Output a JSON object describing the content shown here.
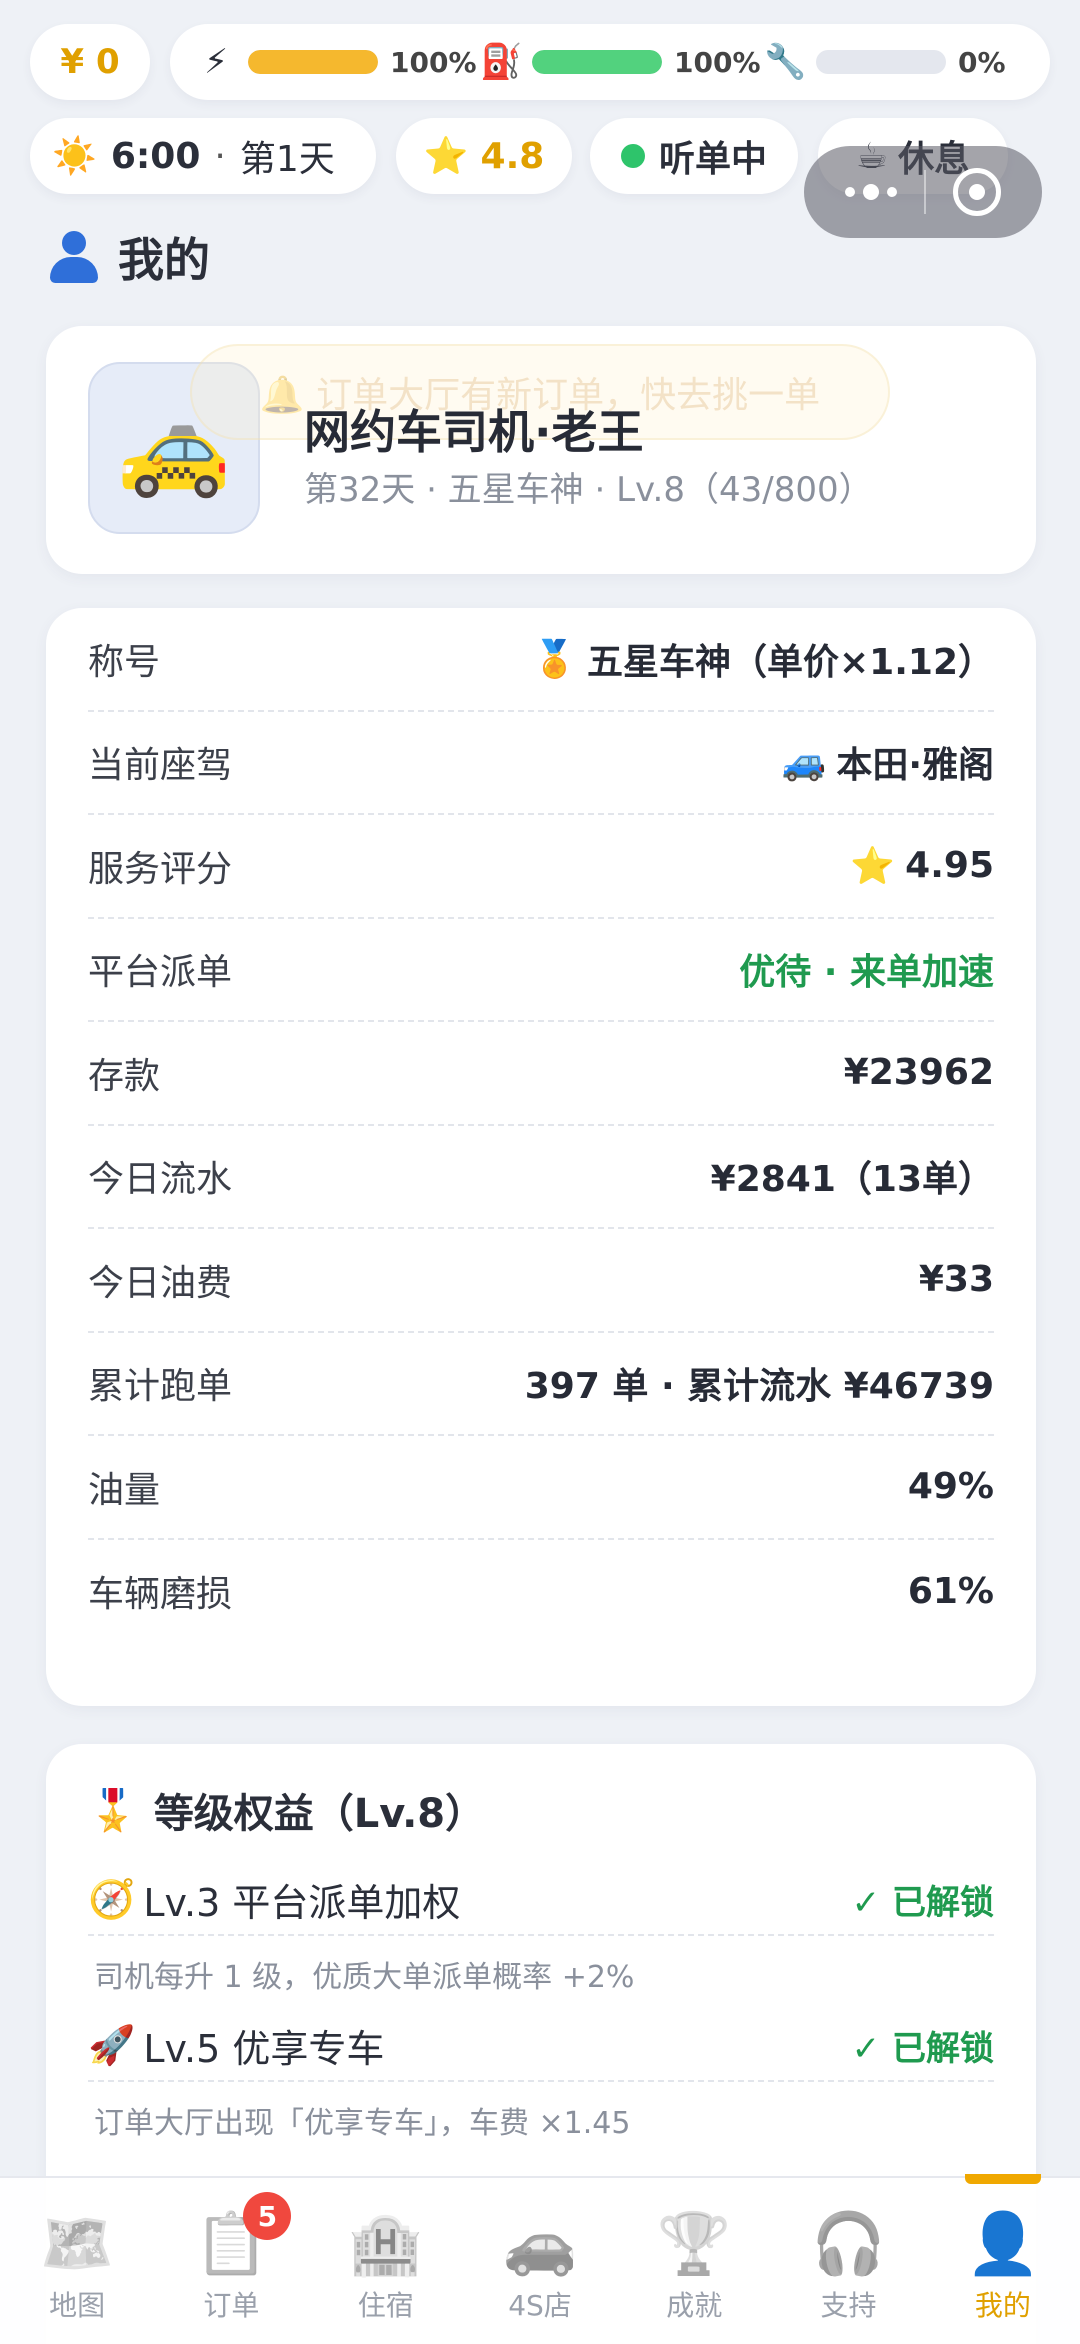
{
  "status": {
    "money": "0",
    "money_icon": "¥",
    "meters": [
      {
        "icon": "⚡",
        "icon_name": "energy-icon",
        "value_text": "100%",
        "fraction": 1.0,
        "color": "#f5b82e"
      },
      {
        "icon": "⛽",
        "icon_name": "fuel-icon",
        "value_text": "100%",
        "fraction": 1.0,
        "color": "#52d27e"
      },
      {
        "icon": "🔧",
        "icon_name": "wrench-icon",
        "value_text": "0%",
        "fraction": 0.0,
        "color": "#c9ced8"
      }
    ],
    "time": "6:00",
    "dot": "·",
    "day": "第1天",
    "rating": "4.8",
    "listening": "听单中",
    "rest": "休息"
  },
  "section_title": "我的",
  "profile": {
    "avatar": "🚕",
    "toast": "🔔 订单大厅有新订单，快去挑一单",
    "name": "网约车司机·老王",
    "subtitle": "第32天 · 五星车神 · Lv.8（43/800）"
  },
  "stats": [
    {
      "label": "称号",
      "icon": "🏅",
      "value": "五星车神（单价×1.12）"
    },
    {
      "label": "当前座驾",
      "icon": "🚙",
      "value": "本田·雅阁"
    },
    {
      "label": "服务评分",
      "icon": "⭐",
      "value": "4.95"
    },
    {
      "label": "平台派单",
      "icon": "",
      "value": "优待 · 来单加速",
      "color": "#1f9a4f"
    },
    {
      "label": "存款",
      "icon": "",
      "value": "¥23962"
    },
    {
      "label": "今日流水",
      "icon": "",
      "value": "¥2841（13单）"
    },
    {
      "label": "今日油费",
      "icon": "",
      "value": "¥33"
    },
    {
      "label": "累计跑单",
      "icon": "",
      "value": "397 单 · 累计流水 ¥46739"
    },
    {
      "label": "油量",
      "icon": "",
      "value": "49%"
    },
    {
      "label": "车辆磨损",
      "icon": "",
      "value": "61%"
    }
  ],
  "perks": {
    "icon": "🎖️",
    "title": "等级权益（Lv.8）",
    "items": [
      {
        "icon": "🧭",
        "name": "Lv.3 平台派单加权",
        "status": "✓ 已解锁",
        "desc": "司机每升 1 级，优质大单派单概率 +2%"
      },
      {
        "icon": "🚀",
        "name": "Lv.5 优享专车",
        "status": "✓ 已解锁",
        "desc": "订单大厅出现「优享专车」，车费 ×1.45"
      }
    ]
  },
  "nav": [
    {
      "icon": "🗺️",
      "label": "地图",
      "name": "map"
    },
    {
      "icon": "📋",
      "label": "订单",
      "name": "orders",
      "badge": "5"
    },
    {
      "icon": "🏨",
      "label": "住宿",
      "name": "lodging"
    },
    {
      "icon": "🚗",
      "label": "4S店",
      "name": "4s-shop"
    },
    {
      "icon": "🏆",
      "label": "成就",
      "name": "achievements"
    },
    {
      "icon": "🎧",
      "label": "支持",
      "name": "support"
    },
    {
      "icon": "👤",
      "label": "我的",
      "name": "me",
      "active": true
    }
  ],
  "colors": {
    "accent": "#e0a000",
    "green": "#1f9a4f",
    "badge": "#f0483e"
  }
}
